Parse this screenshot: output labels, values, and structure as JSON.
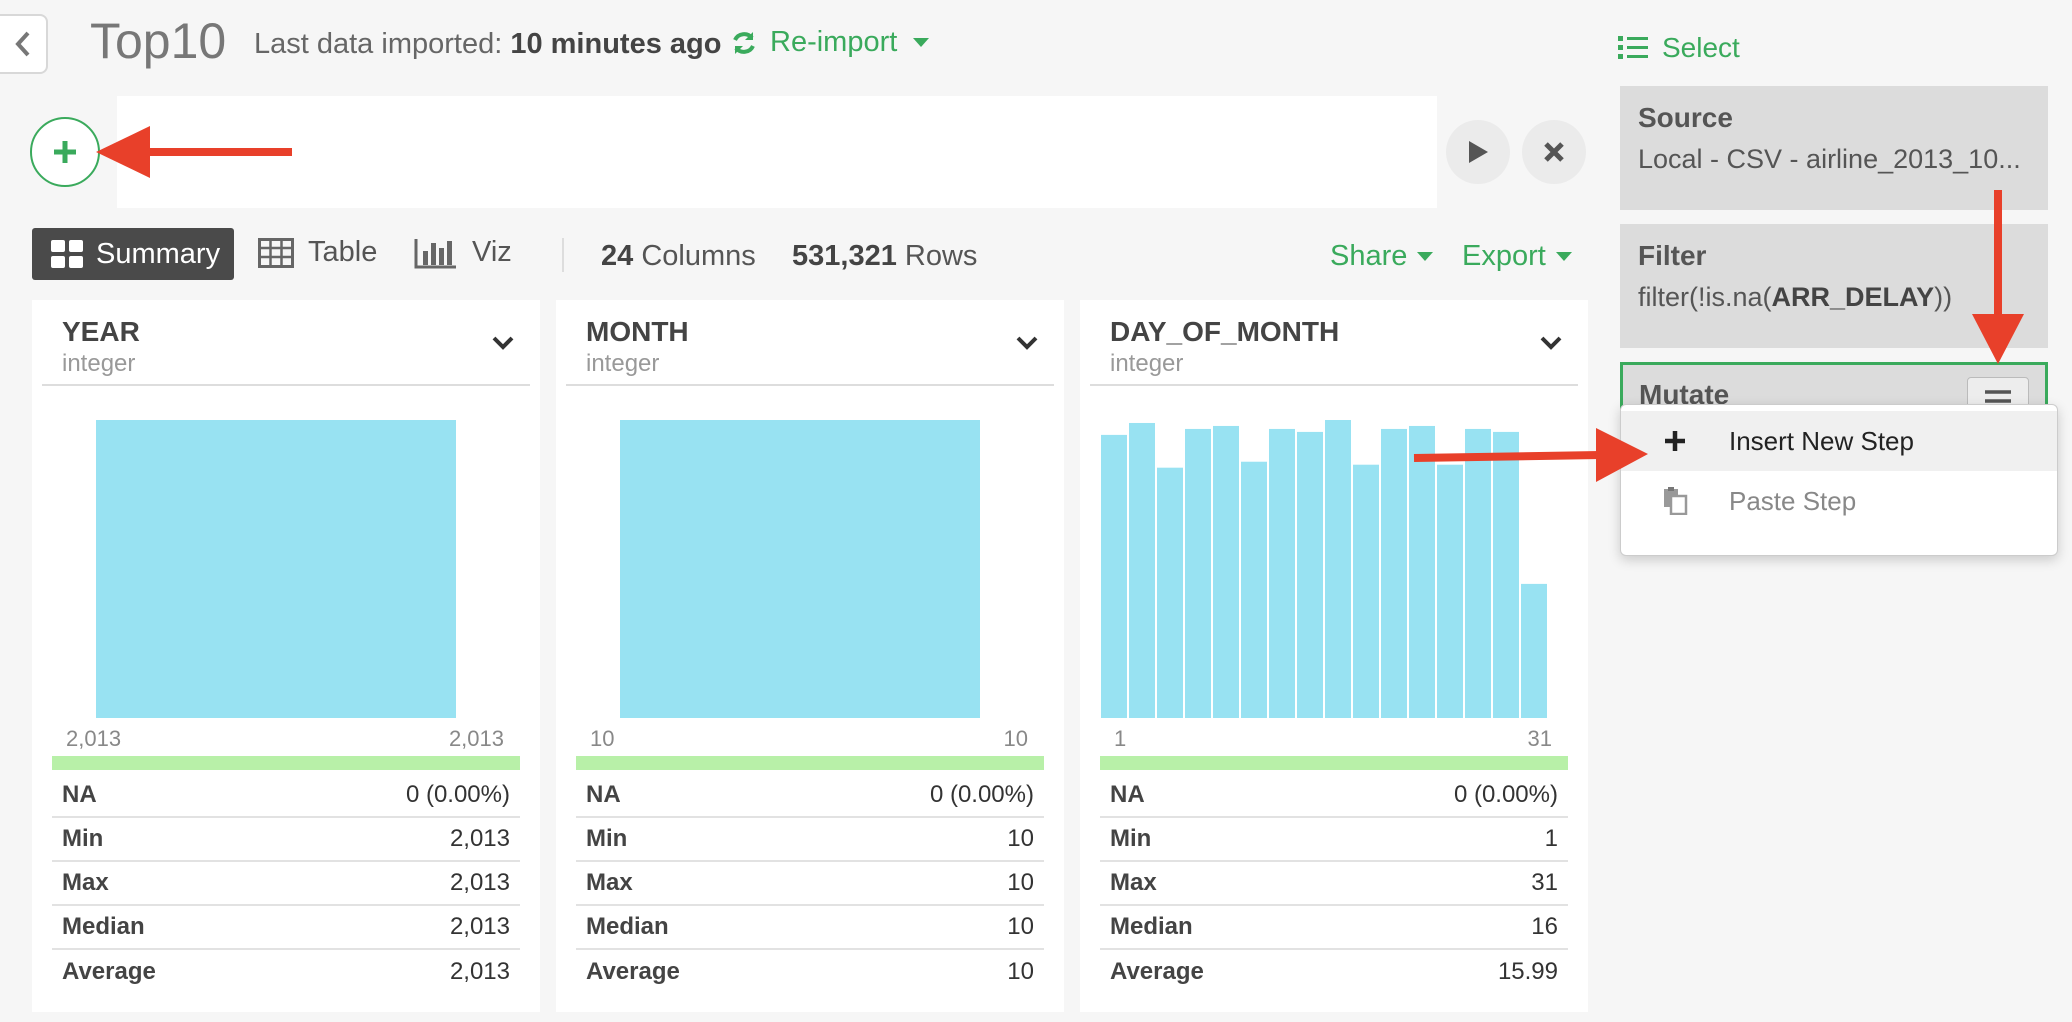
{
  "header": {
    "title": "Top10",
    "imported_label": "Last data imported:",
    "imported_value": "10 minutes ago",
    "reimport_label": "Re-import"
  },
  "toolbar": {
    "summary_label": "Summary",
    "table_label": "Table",
    "viz_label": "Viz",
    "columns_count": "24",
    "columns_label": "Columns",
    "rows_count": "531,321",
    "rows_label": "Rows",
    "share_label": "Share",
    "export_label": "Export"
  },
  "columns": [
    {
      "name": "YEAR",
      "type": "integer",
      "hist_min": "2,013",
      "hist_max": "2,013",
      "histogram": [
        1
      ],
      "stats": [
        {
          "label": "NA",
          "value": "0 (0.00%)"
        },
        {
          "label": "Min",
          "value": "2,013"
        },
        {
          "label": "Max",
          "value": "2,013"
        },
        {
          "label": "Median",
          "value": "2,013"
        },
        {
          "label": "Average",
          "value": "2,013"
        }
      ]
    },
    {
      "name": "MONTH",
      "type": "integer",
      "hist_min": "10",
      "hist_max": "10",
      "histogram": [
        1
      ],
      "stats": [
        {
          "label": "NA",
          "value": "0 (0.00%)"
        },
        {
          "label": "Min",
          "value": "10"
        },
        {
          "label": "Max",
          "value": "10"
        },
        {
          "label": "Median",
          "value": "10"
        },
        {
          "label": "Average",
          "value": "10"
        }
      ]
    },
    {
      "name": "DAY_OF_MONTH",
      "type": "integer",
      "hist_min": "1",
      "hist_max": "31",
      "histogram": [
        0.95,
        0.99,
        0.84,
        0.97,
        0.98,
        0.86,
        0.97,
        0.96,
        1.0,
        0.85,
        0.97,
        0.98,
        0.85,
        0.97,
        0.96,
        0.45
      ],
      "stats": [
        {
          "label": "NA",
          "value": "0 (0.00%)"
        },
        {
          "label": "Min",
          "value": "1"
        },
        {
          "label": "Max",
          "value": "31"
        },
        {
          "label": "Median",
          "value": "16"
        },
        {
          "label": "Average",
          "value": "15.99"
        }
      ]
    }
  ],
  "right_panel": {
    "select_label": "Select",
    "steps": [
      {
        "title": "Source",
        "desc": "Local - CSV - airline_2013_10..."
      },
      {
        "title": "Filter",
        "desc_pre": "filter(!is.na(",
        "desc_bold": "ARR_DELAY",
        "desc_post": "))"
      },
      {
        "title": "Mutate"
      }
    ],
    "menu": {
      "insert_label": "Insert New Step",
      "paste_label": "Paste Step"
    }
  },
  "colors": {
    "accent_green": "#3aaa5c",
    "histogram_bar": "#98e2f2",
    "valid_bar": "#b8f0a8",
    "arrow_red": "#e8402a"
  }
}
